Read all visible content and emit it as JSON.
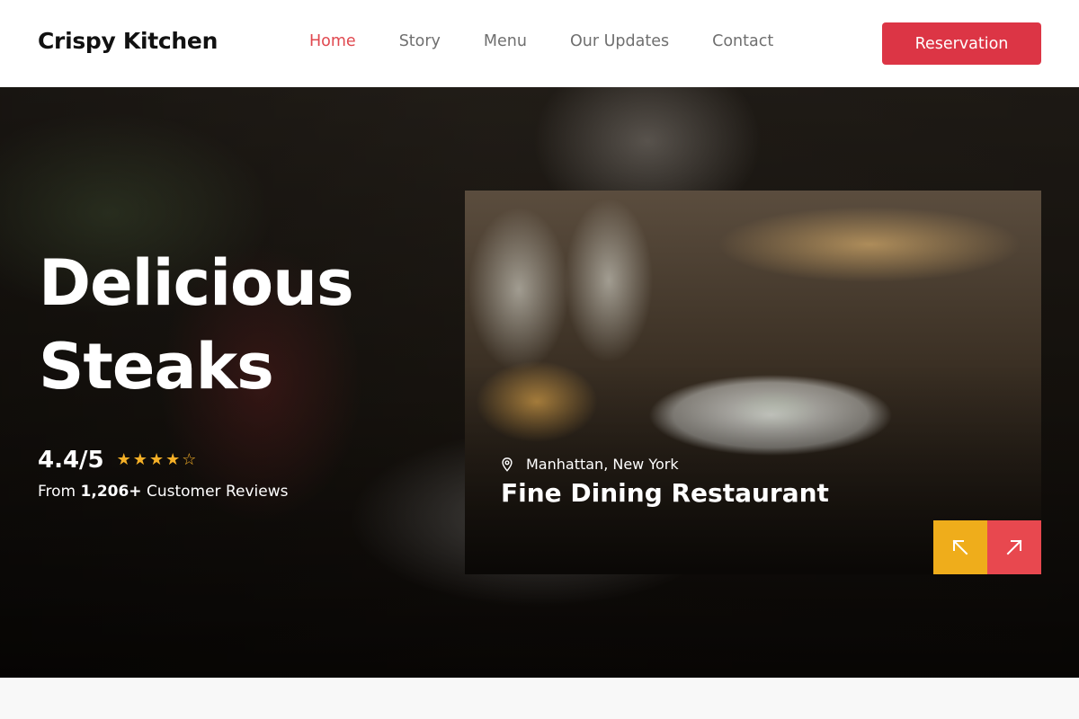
{
  "brand": "Crispy Kitchen",
  "nav": {
    "items": [
      "Home",
      "Story",
      "Menu",
      "Our Updates",
      "Contact"
    ],
    "active": "Home",
    "reservation_label": "Reservation"
  },
  "hero": {
    "title_line1": "Delicious",
    "title_line2": "Steaks",
    "rating_score": "4.4/5",
    "rating_value": 4.4,
    "rating_max": 5,
    "reviews_prefix": "From",
    "reviews_count": "1,206+",
    "reviews_suffix": "Customer Reviews"
  },
  "card": {
    "location": "Manhattan, New York",
    "title": "Fine Dining Restaurant",
    "prev_icon": "arrow-up-left-icon",
    "next_icon": "arrow-up-right-icon"
  },
  "colors": {
    "accent_red": "#dc3545",
    "accent_yellow": "#efad1b",
    "star": "#f5b027"
  }
}
